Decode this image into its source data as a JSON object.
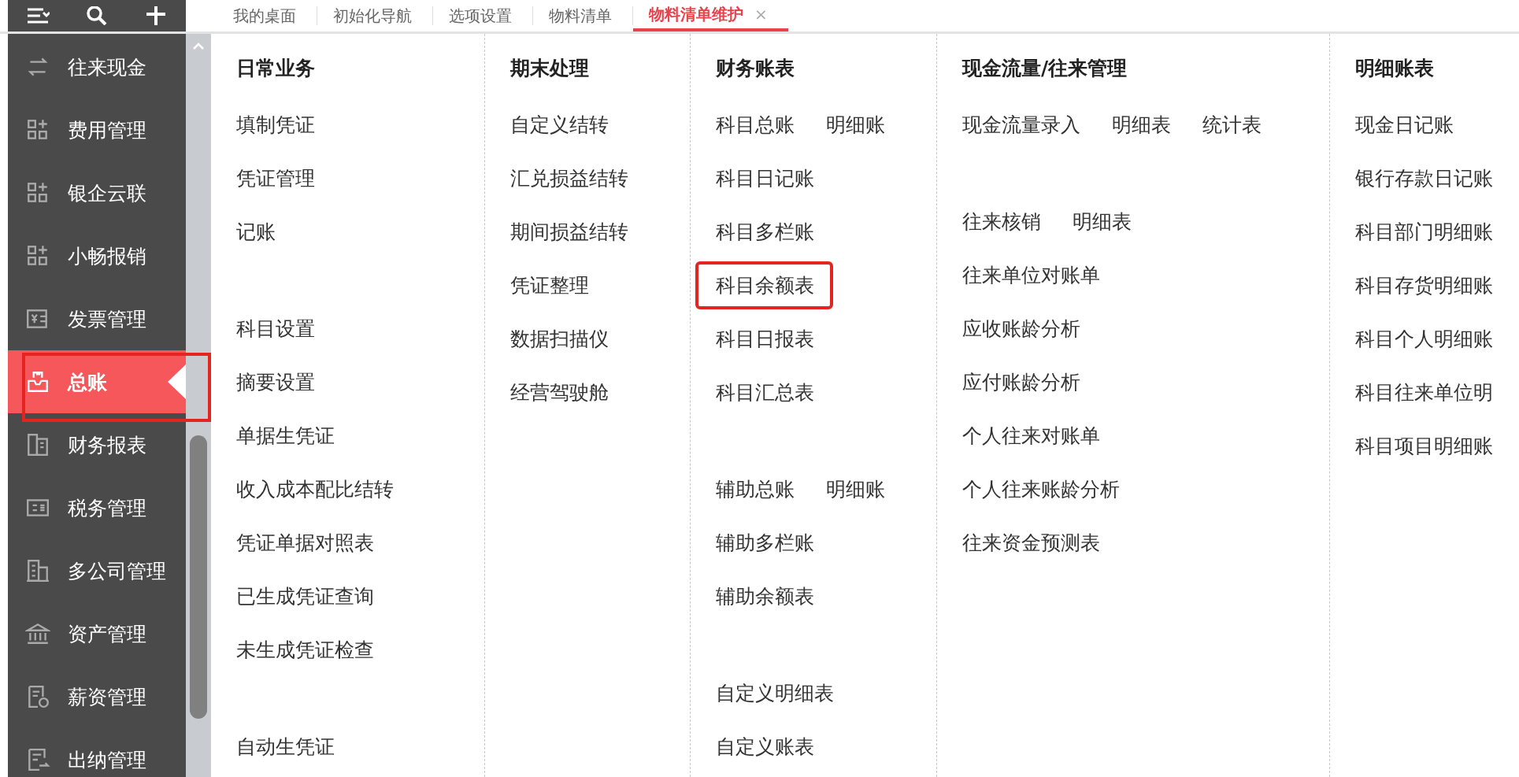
{
  "tabs": [
    {
      "label": "我的桌面",
      "selected": false
    },
    {
      "label": "初始化导航",
      "selected": false
    },
    {
      "label": "选项设置",
      "selected": false
    },
    {
      "label": "物料清单",
      "selected": false
    },
    {
      "label": "物料清单维护",
      "selected": true,
      "close": "×"
    }
  ],
  "sidebar": {
    "items": [
      {
        "label": "往来现金",
        "selected": false,
        "highlighted": false
      },
      {
        "label": "费用管理",
        "selected": false,
        "highlighted": false
      },
      {
        "label": "银企云联",
        "selected": false,
        "highlighted": false
      },
      {
        "label": "小畅报销",
        "selected": false,
        "highlighted": false
      },
      {
        "label": "发票管理",
        "selected": false,
        "highlighted": false
      },
      {
        "label": "总账",
        "selected": true,
        "highlighted": true
      },
      {
        "label": "财务报表",
        "selected": false,
        "highlighted": false
      },
      {
        "label": "税务管理",
        "selected": false,
        "highlighted": false
      },
      {
        "label": "多公司管理",
        "selected": false,
        "highlighted": false
      },
      {
        "label": "资产管理",
        "selected": false,
        "highlighted": false
      },
      {
        "label": "薪资管理",
        "selected": false,
        "highlighted": false
      },
      {
        "label": "出纳管理",
        "selected": false,
        "highlighted": false
      }
    ]
  },
  "menu": {
    "columns": [
      {
        "title": "日常业务",
        "groups": [
          [
            {
              "label": "填制凭证",
              "highlighted": false
            },
            {
              "label": "凭证管理",
              "highlighted": false
            },
            {
              "label": "记账",
              "highlighted": false
            }
          ],
          [
            {
              "label": "科目设置",
              "highlighted": false
            },
            {
              "label": "摘要设置",
              "highlighted": false
            },
            {
              "label": "单据生凭证",
              "highlighted": false
            },
            {
              "label": "收入成本配比结转",
              "highlighted": false
            },
            {
              "label": "凭证单据对照表",
              "highlighted": false
            },
            {
              "label": "已生成凭证查询",
              "highlighted": false
            },
            {
              "label": "未生成凭证检查",
              "highlighted": false
            }
          ],
          [
            {
              "label": "自动生凭证",
              "highlighted": false
            }
          ]
        ]
      },
      {
        "title": "期末处理",
        "groups": [
          [
            {
              "label": "自定义结转",
              "highlighted": false
            },
            {
              "label": "汇兑损益结转",
              "highlighted": false
            },
            {
              "label": "期间损益结转",
              "highlighted": false
            },
            {
              "label": "凭证整理",
              "highlighted": false
            },
            {
              "label": "数据扫描仪",
              "highlighted": false
            },
            {
              "label": "经营驾驶舱",
              "highlighted": false
            }
          ]
        ]
      },
      {
        "title": "财务账表",
        "groups": [
          [
            {
              "label": "科目总账",
              "links": [
                "明细账"
              ],
              "highlighted": false
            },
            {
              "label": "科目日记账",
              "highlighted": false
            },
            {
              "label": "科目多栏账",
              "highlighted": false
            },
            {
              "label": "科目余额表",
              "highlighted": true
            },
            {
              "label": "科目日报表",
              "highlighted": false
            },
            {
              "label": "科目汇总表",
              "highlighted": false
            }
          ],
          [
            {
              "label": "辅助总账",
              "links": [
                "明细账"
              ],
              "highlighted": false
            },
            {
              "label": "辅助多栏账",
              "highlighted": false
            },
            {
              "label": "辅助余额表",
              "highlighted": false
            }
          ],
          [
            {
              "label": "自定义明细表",
              "highlighted": false
            },
            {
              "label": "自定义账表",
              "highlighted": false
            }
          ]
        ]
      },
      {
        "title": "现金流量/往来管理",
        "groups": [
          [
            {
              "label": "现金流量录入",
              "links": [
                "明细表",
                "统计表"
              ],
              "highlighted": false
            }
          ],
          [
            {
              "label": "往来核销",
              "links": [
                "明细表"
              ],
              "highlighted": false
            },
            {
              "label": "往来单位对账单",
              "highlighted": false
            },
            {
              "label": "应收账龄分析",
              "highlighted": false
            },
            {
              "label": "应付账龄分析",
              "highlighted": false
            },
            {
              "label": "个人往来对账单",
              "highlighted": false
            },
            {
              "label": "个人往来账龄分析",
              "highlighted": false
            },
            {
              "label": "往来资金预测表",
              "highlighted": false
            }
          ]
        ]
      },
      {
        "title": "明细账表",
        "groups": [
          [
            {
              "label": "现金日记账",
              "highlighted": false
            },
            {
              "label": "银行存款日记账",
              "highlighted": false
            },
            {
              "label": "科目部门明细账",
              "highlighted": false
            },
            {
              "label": "科目存货明细账",
              "highlighted": false
            },
            {
              "label": "科目个人明细账",
              "highlighted": false
            },
            {
              "label": "科目往来单位明",
              "highlighted": false
            },
            {
              "label": "科目项目明细账",
              "highlighted": false
            }
          ]
        ]
      }
    ]
  }
}
